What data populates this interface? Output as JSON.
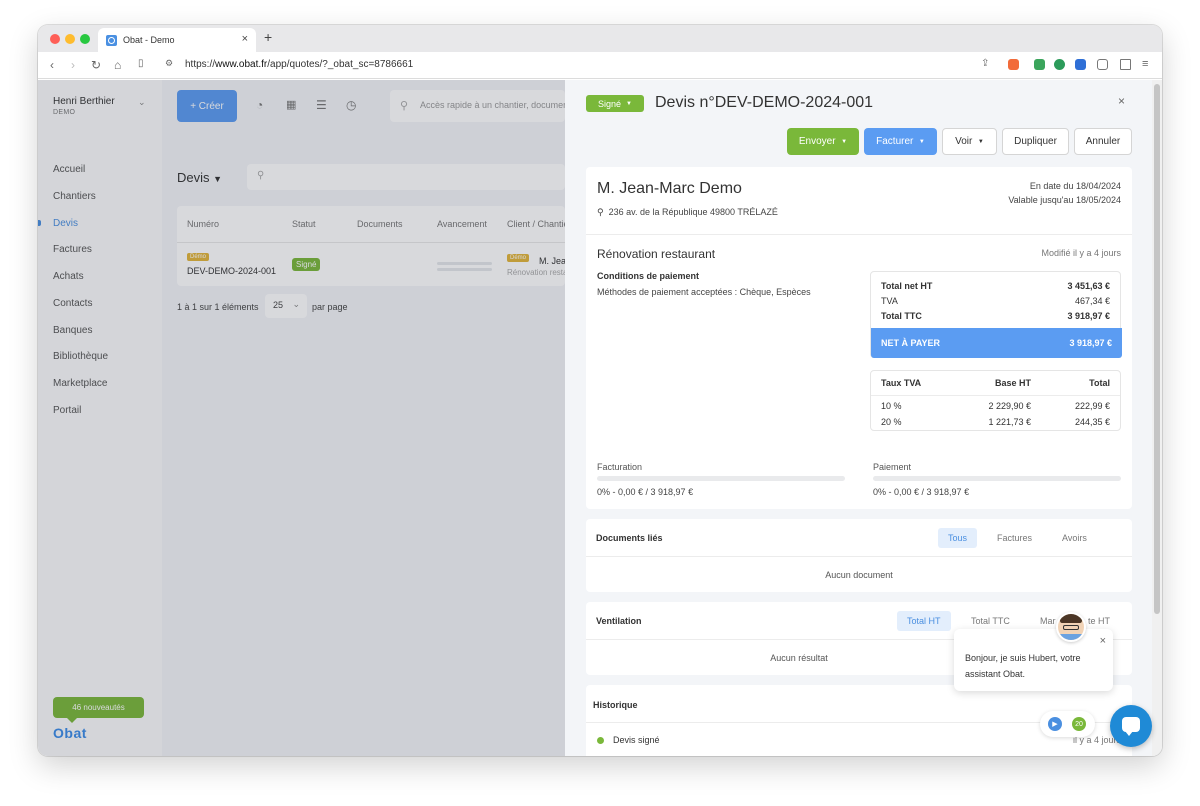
{
  "browser": {
    "tab_title": "Obat - Demo",
    "tab_close": "×",
    "new_tab": "+",
    "url_prefix": "https://",
    "url_host": "www.obat.fr",
    "url_path": "/app/quotes/?_obat_sc=8786661"
  },
  "sidebar": {
    "user_name": "Henri Berthier",
    "user_sub": "DEMO",
    "items": [
      "Accueil",
      "Chantiers",
      "Devis",
      "Factures",
      "Achats",
      "Contacts",
      "Banques",
      "Bibliothèque",
      "Marketplace",
      "Portail"
    ],
    "active_item": "Devis",
    "news": "46 nouveautés",
    "logo": "Obat"
  },
  "main": {
    "create_label": "+ Créer",
    "quick_search_placeholder": "Accès rapide à un chantier, document",
    "list_title": "Devis",
    "table": {
      "columns": [
        "Numéro",
        "Statut",
        "Documents",
        "Avancement",
        "Client / Chantier"
      ],
      "rows": [
        {
          "badge": "Démo",
          "number": "DEV-DEMO-2024-001",
          "status": "Signé",
          "client_badge": "Démo",
          "client": "M. Jean",
          "project": "Rénovation resta"
        }
      ]
    },
    "pagination": "1 à 1 sur 1 éléments",
    "per_page_value": "25",
    "per_page_label": "par page"
  },
  "panel": {
    "status": "Signé",
    "title": "Devis n°DEV-DEMO-2024-001",
    "close": "×",
    "actions": {
      "send": "Envoyer",
      "invoice": "Facturer",
      "view": "Voir",
      "duplicate": "Dupliquer",
      "cancel": "Annuler"
    },
    "client": "M. Jean-Marc Demo",
    "address": "236 av. de la République 49800 TRÉLAZÉ",
    "date_line": "En date du 18/04/2024",
    "valid_line": "Valable jusqu'au 18/05/2024",
    "subject": "Rénovation restaurant",
    "modified": "Modifié il y a 4 jours",
    "conditions_title": "Conditions de paiement",
    "conditions_text": "Méthodes de paiement acceptées : Chèque, Espèces",
    "totals": {
      "ht_label": "Total net HT",
      "ht_value": "3 451,63 €",
      "tva_label": "TVA",
      "tva_value": "467,34 €",
      "ttc_label": "Total TTC",
      "ttc_value": "3 918,97 €",
      "net_label": "NET À PAYER",
      "net_value": "3 918,97 €"
    },
    "tva_table": {
      "headers": [
        "Taux TVA",
        "Base HT",
        "Total"
      ],
      "rows": [
        [
          "10 %",
          "2 229,90 €",
          "222,99 €"
        ],
        [
          "20 %",
          "1 221,73 €",
          "244,35 €"
        ]
      ]
    },
    "billing_label": "Facturation",
    "billing_progress": 0,
    "billing_value": "0% - 0,00 € / 3 918,97 €",
    "payment_label": "Paiement",
    "payment_progress": 0,
    "payment_value": "0% - 0,00 € / 3 918,97 €",
    "linked_docs": {
      "title": "Documents liés",
      "filters": [
        "Tous",
        "Factures",
        "Avoirs"
      ],
      "empty": "Aucun document"
    },
    "ventilation": {
      "title": "Ventilation",
      "filters": [
        "Total HT",
        "Total TTC",
        "Mar",
        "te HT"
      ],
      "empty": "Aucun résultat"
    },
    "history": {
      "title": "Historique",
      "event": "Devis signé",
      "time": "il y a 4 jours"
    }
  },
  "chat": {
    "message": "Bonjour, je suis Hubert, votre assistant Obat.",
    "close": "×",
    "count": "20"
  }
}
